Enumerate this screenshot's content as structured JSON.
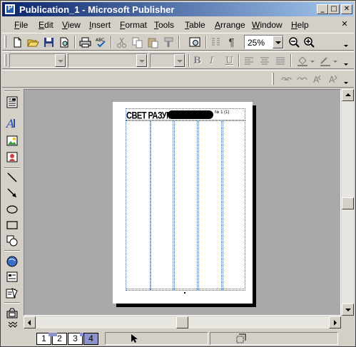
{
  "window": {
    "title": "Publication_1 - Microsoft Publisher",
    "minimize": "_",
    "maximize": "□",
    "close": "✕"
  },
  "menu": {
    "items": [
      {
        "label": "File",
        "ul": "F",
        "rest": "ile"
      },
      {
        "label": "Edit",
        "ul": "E",
        "rest": "dit"
      },
      {
        "label": "View",
        "ul": "V",
        "rest": "iew"
      },
      {
        "label": "Insert",
        "ul": "I",
        "rest": "nsert"
      },
      {
        "label": "Format",
        "ul": "F",
        "rest": "ormat"
      },
      {
        "label": "Tools",
        "ul": "T",
        "rest": "ools"
      },
      {
        "label": "Table",
        "ul": "T",
        "rest": "able"
      },
      {
        "label": "Arrange",
        "ul": "A",
        "rest": "rrange"
      },
      {
        "label": "Window",
        "ul": "W",
        "rest": "indow"
      },
      {
        "label": "Help",
        "ul": "H",
        "rest": "elp"
      }
    ],
    "close_doc": "✕"
  },
  "standard_toolbar": {
    "zoom_value": "25%",
    "pilcrow": "¶"
  },
  "format_toolbar": {
    "bold": "B",
    "italic": "I",
    "underline": "U"
  },
  "publication": {
    "masthead": "СВЕТ РАЗУМА",
    "issue": "№ 1 (1)"
  },
  "status": {
    "pages": [
      "1",
      "2",
      "3",
      "4"
    ],
    "active_page": "4"
  },
  "colors": {
    "title_gradient_start": "#0a246a",
    "title_gradient_end": "#a6caf0",
    "workspace": "#a9a9a9",
    "guides": "#2b6bc8",
    "active_page_tab": "#8b93c8"
  },
  "icons": {
    "standard": [
      "new-icon",
      "open-icon",
      "save-icon",
      "search-file-icon",
      "print-icon",
      "spelling-icon",
      "cut-icon",
      "copy-icon",
      "paste-icon",
      "format-painter-icon",
      "insert-object-icon",
      "columns-icon",
      "zoom-out-icon",
      "zoom-in-icon"
    ],
    "object_toolbar": [
      "text-box-icon",
      "word-art-icon",
      "picture-icon",
      "clip-art-icon",
      "line-icon",
      "arrow-icon",
      "oval-icon",
      "rectangle-icon",
      "auto-shapes-icon",
      "hot-spot-icon",
      "form-control-icon",
      "html-fragment-icon",
      "design-gallery-icon",
      "more-icon"
    ]
  }
}
